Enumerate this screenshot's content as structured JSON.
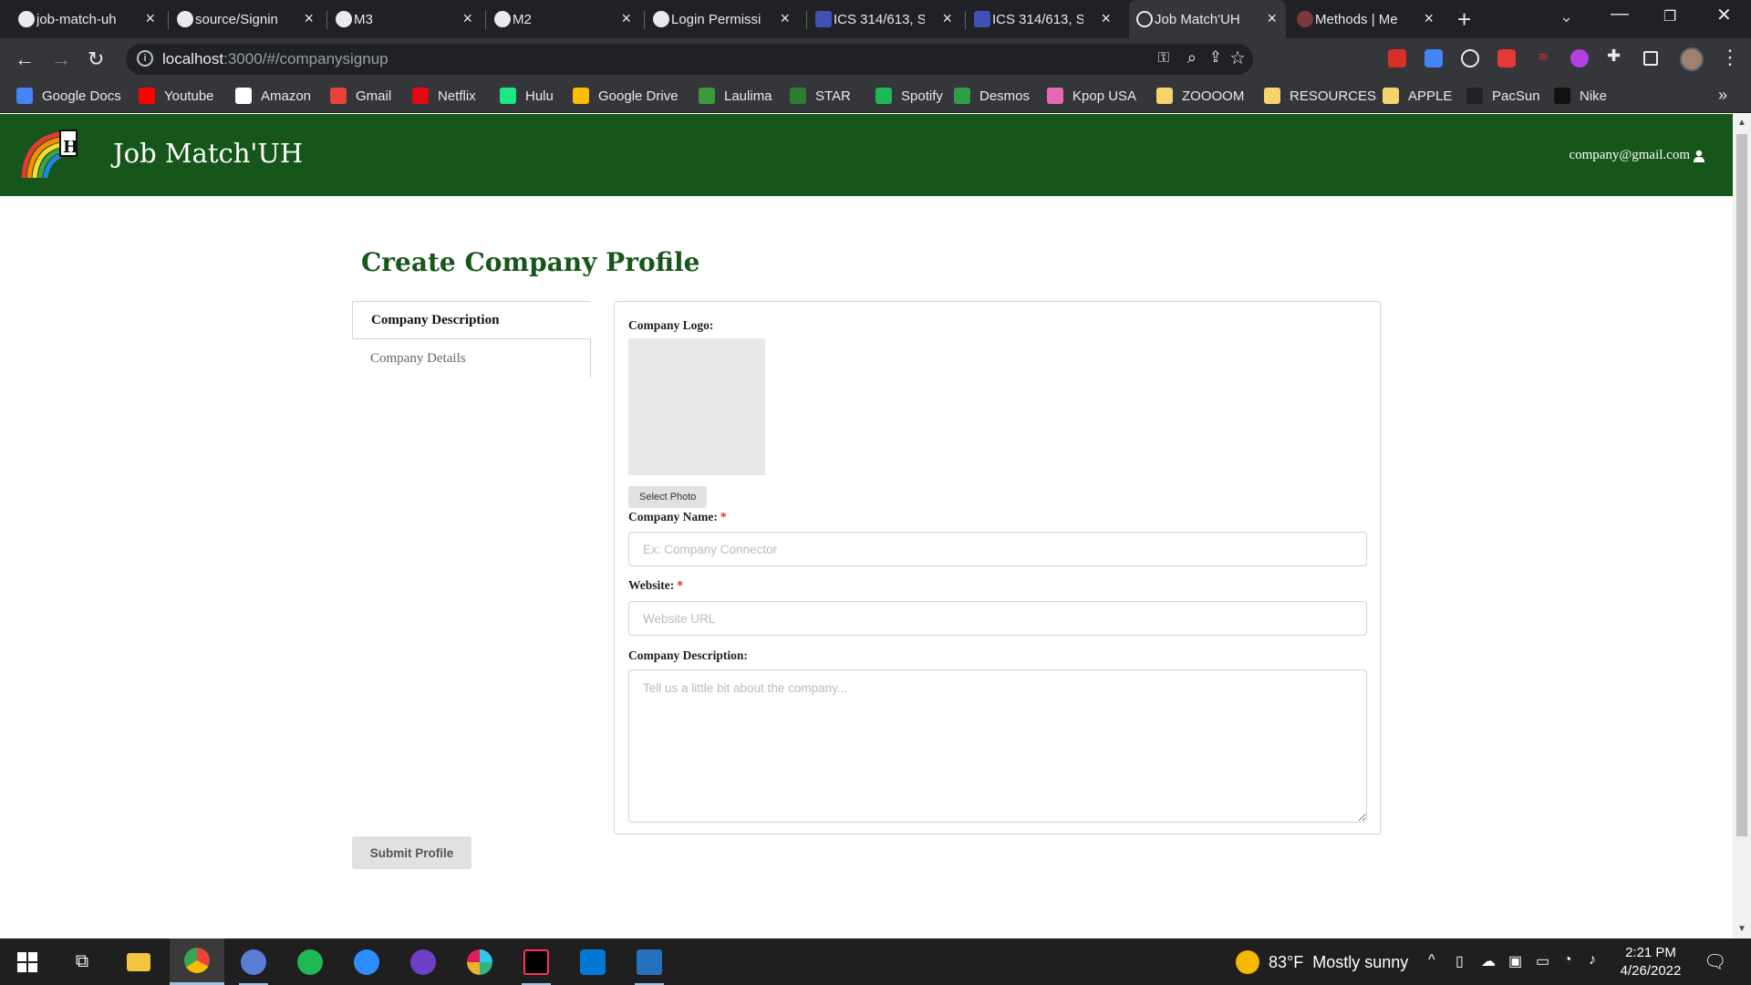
{
  "browser": {
    "tabs": [
      {
        "title": "job-match-uh",
        "favicon": "github-icon",
        "active": false
      },
      {
        "title": "source/Signin",
        "favicon": "github-icon",
        "active": false
      },
      {
        "title": "M3",
        "favicon": "github-icon",
        "active": false
      },
      {
        "title": "M2",
        "favicon": "github-icon",
        "active": false
      },
      {
        "title": "Login Permissi",
        "favicon": "github-icon",
        "active": false
      },
      {
        "title": "ICS 314/613, S",
        "favicon": "doc-icon",
        "active": false
      },
      {
        "title": "ICS 314/613, S",
        "favicon": "doc-icon",
        "active": false
      },
      {
        "title": "Job Match'UH",
        "favicon": "app-icon",
        "active": true
      },
      {
        "title": "Methods | Me",
        "favicon": "meteor-icon",
        "active": false
      }
    ],
    "address": {
      "host": "localhost",
      "path": ":3000/#/companysignup"
    },
    "bookmarks": [
      {
        "label": "Google Docs",
        "icon": "google-docs-icon",
        "color": "#4285f4"
      },
      {
        "label": "Youtube",
        "icon": "youtube-icon",
        "color": "#ff0000"
      },
      {
        "label": "Amazon",
        "icon": "amazon-icon",
        "color": "#ffffff"
      },
      {
        "label": "Gmail",
        "icon": "gmail-icon",
        "color": "#ea4335"
      },
      {
        "label": "Netflix",
        "icon": "netflix-icon",
        "color": "#e50914"
      },
      {
        "label": "Hulu",
        "icon": "hulu-icon",
        "color": "#1ce783"
      },
      {
        "label": "Google Drive",
        "icon": "google-drive-icon",
        "color": "#fbbc04"
      },
      {
        "label": "Laulima",
        "icon": "laulima-icon",
        "color": "#3c9a3c"
      },
      {
        "label": "STAR",
        "icon": "star-icon",
        "color": "#2e7d32"
      },
      {
        "label": "Spotify",
        "icon": "spotify-icon",
        "color": "#1db954"
      },
      {
        "label": "Desmos",
        "icon": "desmos-icon",
        "color": "#2f9e44"
      },
      {
        "label": "Kpop USA",
        "icon": "kpop-icon",
        "color": "#e667b5"
      },
      {
        "label": "ZOOOOM",
        "icon": "folder-icon",
        "color": "#f6d36b"
      },
      {
        "label": "RESOURCES",
        "icon": "folder-icon",
        "color": "#f6d36b"
      },
      {
        "label": "APPLE",
        "icon": "folder-icon",
        "color": "#f6d36b"
      },
      {
        "label": "PacSun",
        "icon": "pacsun-icon",
        "color": "#222222"
      },
      {
        "label": "Nike",
        "icon": "nike-icon",
        "color": "#111111"
      }
    ]
  },
  "app": {
    "brand": "Job Match'UH",
    "user_email": "company@gmail.com",
    "brand_color": "#17561a"
  },
  "page": {
    "title": "Create Company Profile",
    "side_nav": [
      {
        "label": "Company Description",
        "active": true
      },
      {
        "label": "Company Details",
        "active": false
      }
    ],
    "form": {
      "logo_label": "Company Logo:",
      "select_photo": "Select Photo",
      "name_label": "Company Name:",
      "name_placeholder": "Ex: Company Connector",
      "name_value": "",
      "website_label": "Website:",
      "website_placeholder": "Website URL",
      "website_value": "",
      "desc_label": "Company Description:",
      "desc_placeholder": "Tell us a little bit about the company...",
      "required_mark": "*"
    },
    "submit_label": "Submit Profile"
  },
  "taskbar": {
    "weather": {
      "temp": "83°F",
      "condition": "Mostly sunny"
    },
    "time": "2:21 PM",
    "date": "4/26/2022"
  }
}
